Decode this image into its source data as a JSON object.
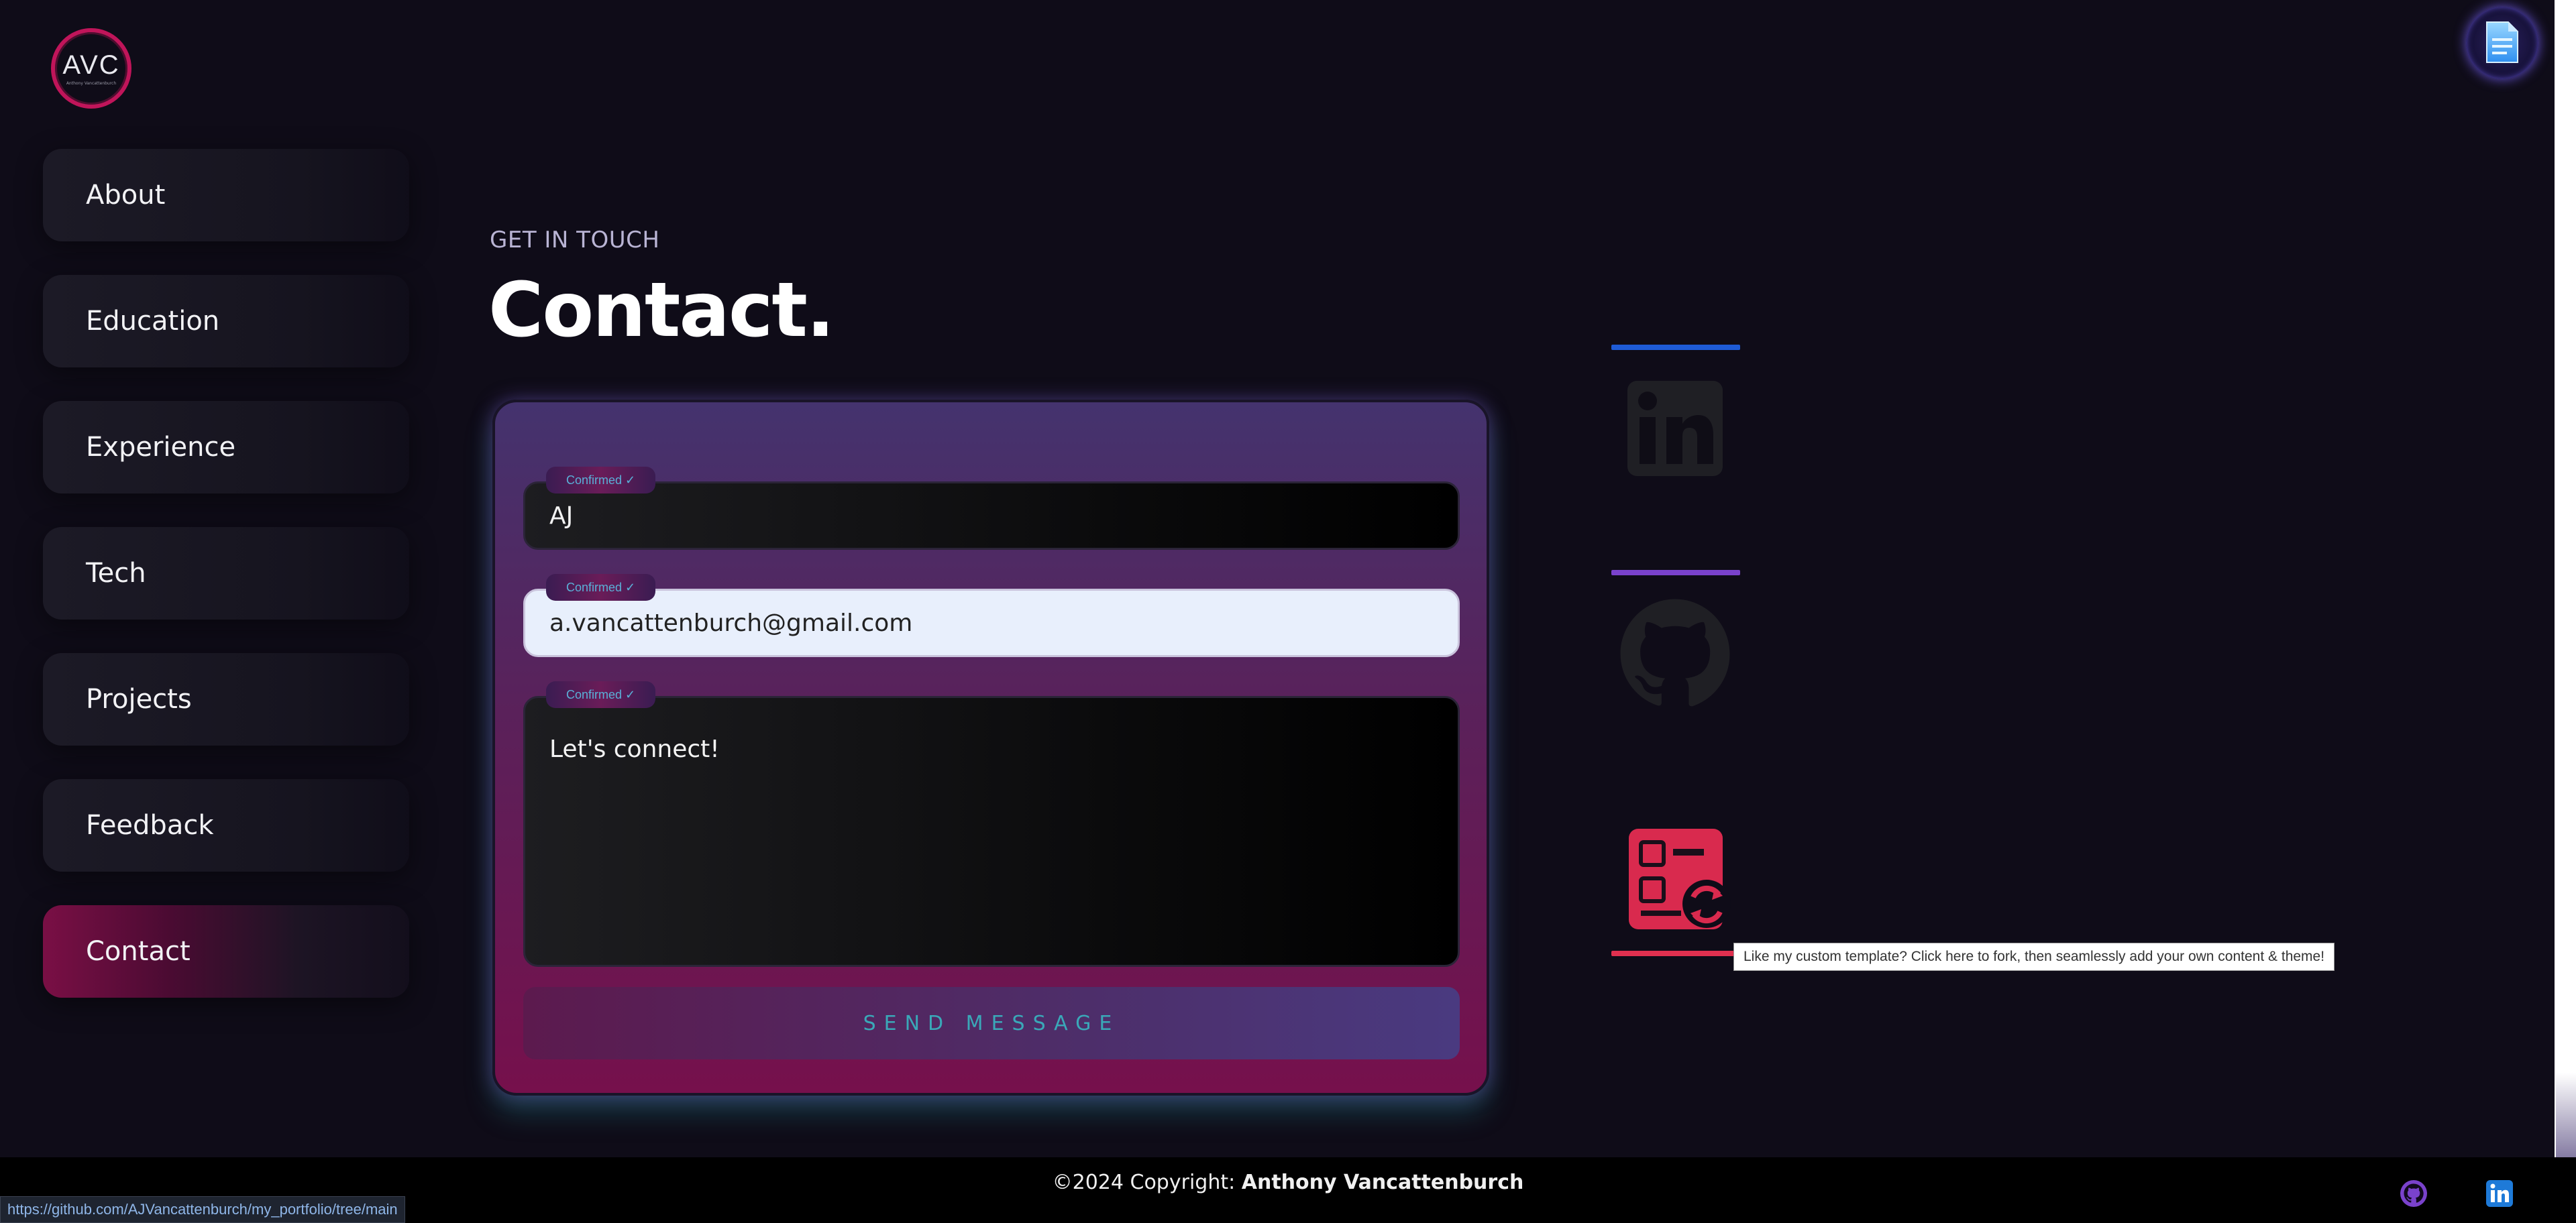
{
  "logo": {
    "text": "AVC",
    "subtext": "Anthony Vancattenburch"
  },
  "nav": {
    "items": [
      {
        "label": "About"
      },
      {
        "label": "Education"
      },
      {
        "label": "Experience"
      },
      {
        "label": "Tech"
      },
      {
        "label": "Projects"
      },
      {
        "label": "Feedback"
      },
      {
        "label": "Contact",
        "active": true
      }
    ]
  },
  "section": {
    "eyebrow": "GET IN TOUCH",
    "title": "Contact."
  },
  "form": {
    "name": {
      "value": "AJ",
      "badge": "Confirmed ✓"
    },
    "email": {
      "value": "a.vancattenburch@gmail.com",
      "badge": "Confirmed ✓"
    },
    "message": {
      "value": "Let's connect!",
      "badge": "Confirmed ✓"
    },
    "submit_label": "SEND MESSAGE"
  },
  "social": {
    "linkedin_icon": "linkedin-icon",
    "github_icon": "github-icon",
    "template_icon": "template-fork-icon",
    "colors": {
      "linkedin_bar": "#1e5bd6",
      "github_bar": "#7a42cc",
      "template_bar": "#e0304f"
    }
  },
  "tooltip": "Like my custom template? Click here to fork, then seamlessly add your own content & theme!",
  "resume_icon": "resume-document-icon",
  "footer": {
    "copyright_prefix": "©2024 Copyright: ",
    "copyright_name": "Anthony Vancattenburch"
  },
  "status_url": "https://github.com/AJVancattenburch/my_portfolio/tree/main"
}
